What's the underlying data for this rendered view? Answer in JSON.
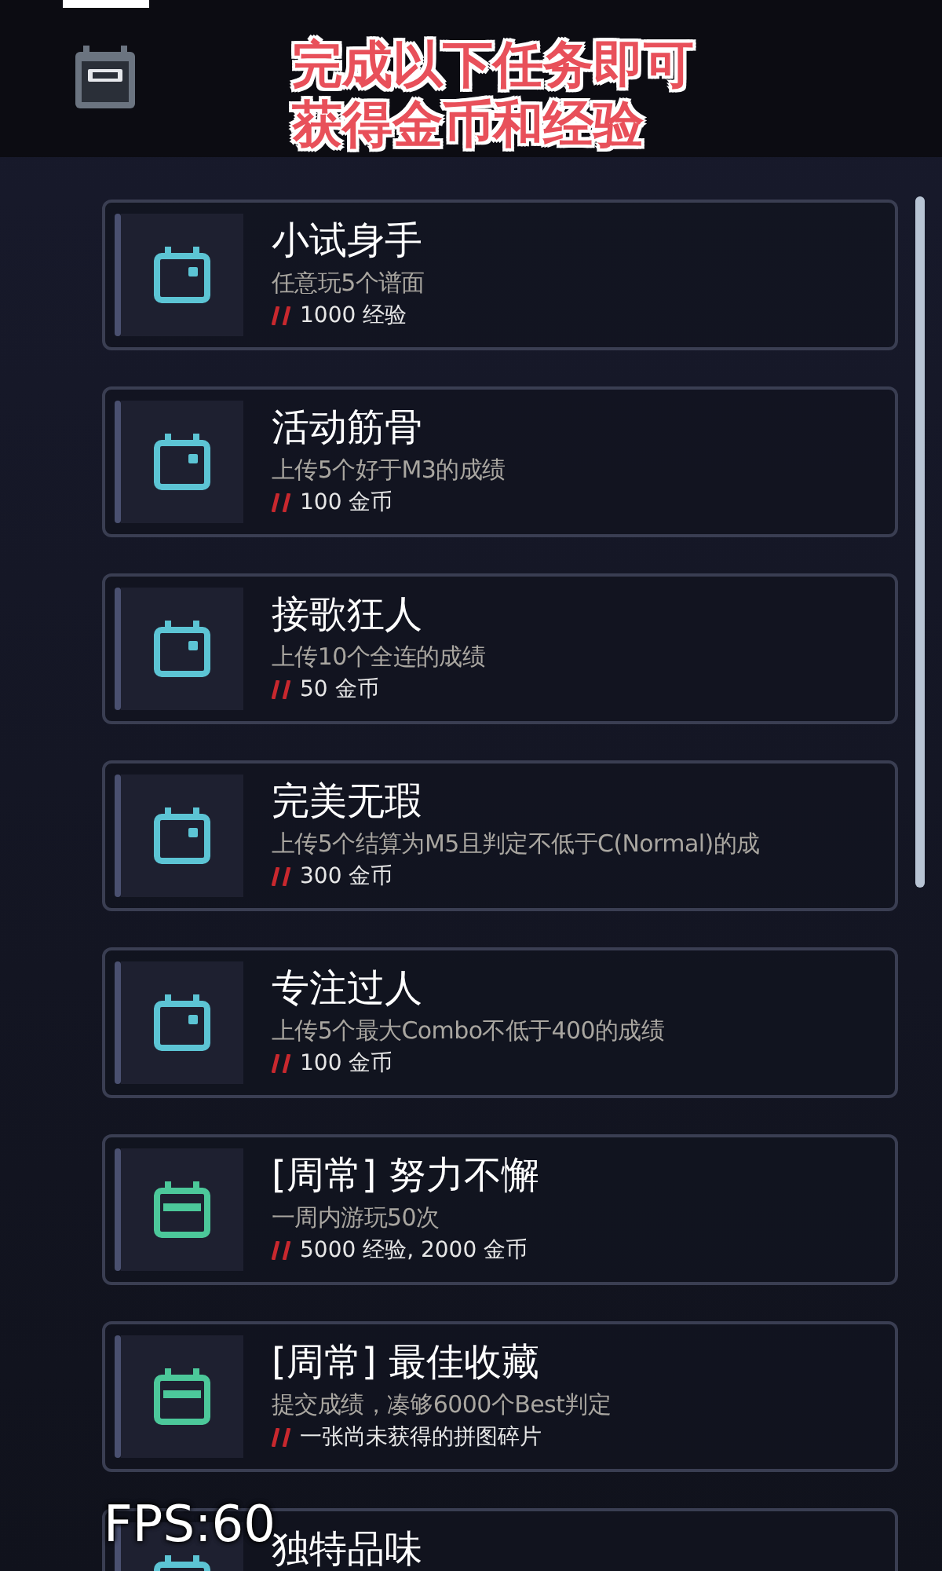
{
  "header": {
    "caption_lines": [
      "完成以下任务即可",
      "获得金币和经验"
    ]
  },
  "tasks": [
    {
      "kind": "daily",
      "title": "小试身手",
      "description": "任意玩5个谱面",
      "reward": "1000 经验"
    },
    {
      "kind": "daily",
      "title": "活动筋骨",
      "description": "上传5个好于M3的成绩",
      "reward": "100 金币"
    },
    {
      "kind": "daily",
      "title": "接歌狂人",
      "description": "上传10个全连的成绩",
      "reward": "50 金币"
    },
    {
      "kind": "daily",
      "title": "完美无瑕",
      "description": "上传5个结算为M5且判定不低于C(Normal)的成",
      "reward": "300 金币"
    },
    {
      "kind": "daily",
      "title": "专注过人",
      "description": "上传5个最大Combo不低于400的成绩",
      "reward": "100 金币"
    },
    {
      "kind": "weekly",
      "title": "[周常] 努力不懈",
      "description": "一周内游玩50次",
      "reward": "5000 经验, 2000 金币"
    },
    {
      "kind": "weekly",
      "title": "[周常] 最佳收藏",
      "description": "提交成绩，凑够6000个Best判定",
      "reward": "一张尚未获得的拼图碎片"
    },
    {
      "kind": "daily",
      "title": "独特品味"
    }
  ],
  "fps": "FPS:60"
}
